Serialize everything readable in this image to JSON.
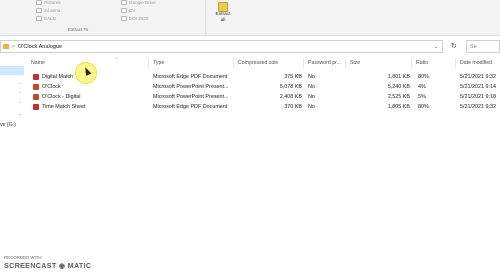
{
  "ribbon": {
    "items": [
      {
        "label": "Pictures"
      },
      {
        "label": "ml.anna"
      },
      {
        "label": "EALD"
      },
      {
        "label": "Google Drive"
      },
      {
        "label": "CV"
      },
      {
        "label": "EOI 2020"
      }
    ],
    "group_label": "Extract To",
    "extract_all_line1": "Extract",
    "extract_all_line2": "all"
  },
  "address": {
    "separator": ">",
    "path": "O'Clock Analogue",
    "dropdown": "⌄",
    "refresh": "↻",
    "search_placeholder": "Se"
  },
  "nav": {
    "pins": [
      "→",
      "→",
      "→",
      "→"
    ],
    "partial_label": "ve (G:)"
  },
  "columns": {
    "name": "Name",
    "type": "Type",
    "compressed": "Compressed size",
    "password": "Password pr...",
    "size": "Size",
    "ratio": "Ratio",
    "date": "Date modified"
  },
  "files": [
    {
      "name": "Digital Match",
      "type": "Microsoft Edge PDF Document",
      "compressed": "375 KB",
      "password": "No",
      "size": "1,801 KB",
      "ratio": "80%",
      "date": "5/21/2021 9:32",
      "icon": "pdf-icon"
    },
    {
      "name": "O'Clock",
      "type": "Microsoft PowerPoint Present...",
      "compressed": "5,078 KB",
      "password": "No",
      "size": "5,240 KB",
      "ratio": "4%",
      "date": "5/21/2021 9:14",
      "icon": "powerpoint-icon"
    },
    {
      "name": "O'Clock - Digital",
      "type": "Microsoft PowerPoint Present...",
      "compressed": "2,408 KB",
      "password": "No",
      "size": "2,525 KB",
      "ratio": "5%",
      "date": "5/21/2021 9:18",
      "icon": "powerpoint-icon"
    },
    {
      "name": "Time Match Sheet",
      "type": "Microsoft Edge PDF Document",
      "compressed": "370 KB",
      "password": "No",
      "size": "1,805 KB",
      "ratio": "80%",
      "date": "5/21/2021 9:32",
      "icon": "pdf-icon"
    }
  ],
  "watermark": {
    "line1": "RECORDED WITH",
    "line2": "SCREENCAST ◉ MATIC"
  },
  "colors": {
    "selection": "#cde8ff",
    "pdf_icon": "#c62f2f",
    "ppt_icon": "#c4472a",
    "folder": "#e8b73a",
    "cursor_highlight": "#fff000"
  }
}
